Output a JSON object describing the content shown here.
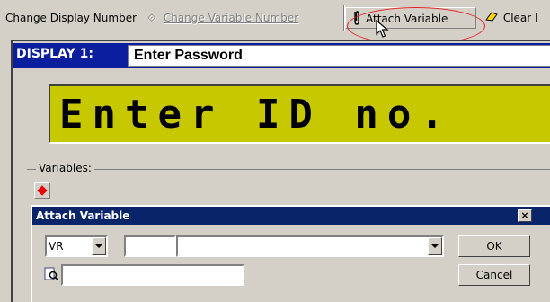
{
  "toolbar": {
    "change_display": "Change Display Number",
    "change_variable": "Change Variable Number",
    "attach_variable": "Attach Variable",
    "clear": "Clear I"
  },
  "display": {
    "label": "DISPLAY 1:",
    "input_value": "Enter Password",
    "lcd_text": "Enter ID no."
  },
  "variables": {
    "legend": "Variables:"
  },
  "dialog": {
    "title": "Attach Variable",
    "close": "×",
    "type_value": "VR",
    "number_value": "",
    "name_value": "",
    "search_value": "",
    "ok": "OK",
    "cancel": "Cancel"
  },
  "icons": {
    "paperclip": "paperclip-icon",
    "eraser": "eraser-icon",
    "arrow": "arrow-icon",
    "search": "search-icon"
  },
  "colors": {
    "title_bar": "#0a246a",
    "display_bar": "#0a1e9e",
    "lcd": "#c8c800",
    "highlight": "#e32222"
  }
}
